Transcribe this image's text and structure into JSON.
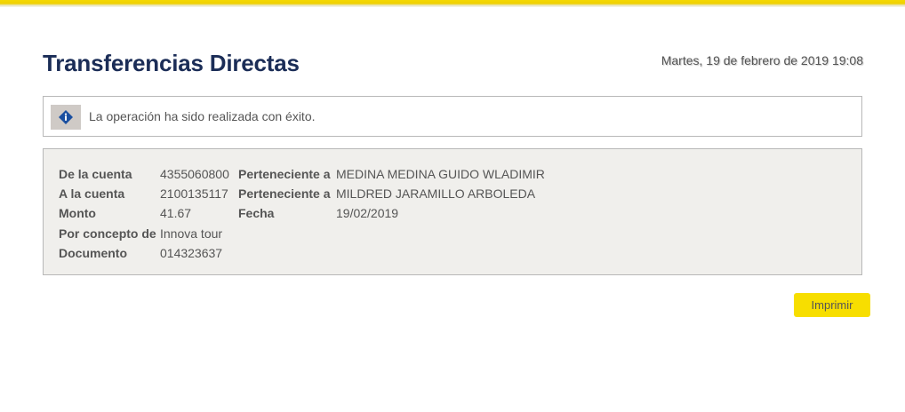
{
  "header": {
    "title": "Transferencias Directas",
    "datetime": "Martes, 19 de febrero de 2019 19:08"
  },
  "notice": {
    "icon": "info-diamond-icon",
    "message": "La operación ha sido realizada con éxito.",
    "icon_color": "#1a4fa0"
  },
  "details": {
    "from_account_label": "De la cuenta",
    "from_account": "4355060800",
    "from_owner_label": "Perteneciente a",
    "from_owner": "MEDINA MEDINA GUIDO WLADIMIR",
    "to_account_label": "A la cuenta",
    "to_account": "2100135117",
    "to_owner_label": "Perteneciente a",
    "to_owner": "MILDRED JARAMILLO ARBOLEDA",
    "amount_label": "Monto",
    "amount": "41.67",
    "date_label": "Fecha",
    "date": "19/02/2019",
    "concept_label": "Por concepto de",
    "concept": "Innova tour",
    "document_label": "Documento",
    "document": "014323637"
  },
  "actions": {
    "print_label": "Imprimir"
  },
  "colors": {
    "accent": "#f7de00",
    "title": "#1b2d57",
    "panel": "#f0efec"
  }
}
